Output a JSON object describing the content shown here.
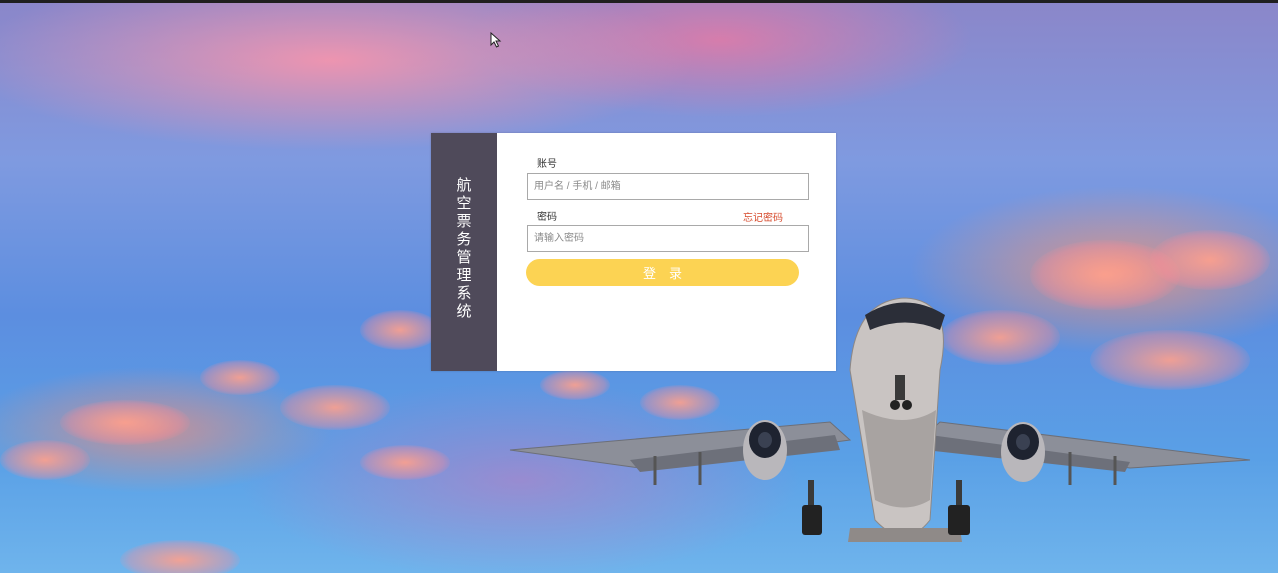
{
  "login": {
    "side_title": "航空票务管理系统",
    "account_label": "账号",
    "account_placeholder": "用户名 / 手机 / 邮箱",
    "account_value": "",
    "password_label": "密码",
    "password_placeholder": "请输入密码",
    "password_value": "",
    "forgot_link": "忘记密码",
    "submit_label": "登　录"
  },
  "colors": {
    "side_panel": "#4f4a5a",
    "submit_button": "#fcd353",
    "forgot_link": "#d64a2c",
    "top_bar": "#1f1f1f"
  },
  "icons": {
    "cursor": "mouse-pointer-icon",
    "background": "airplane-sunset-sky-image"
  }
}
